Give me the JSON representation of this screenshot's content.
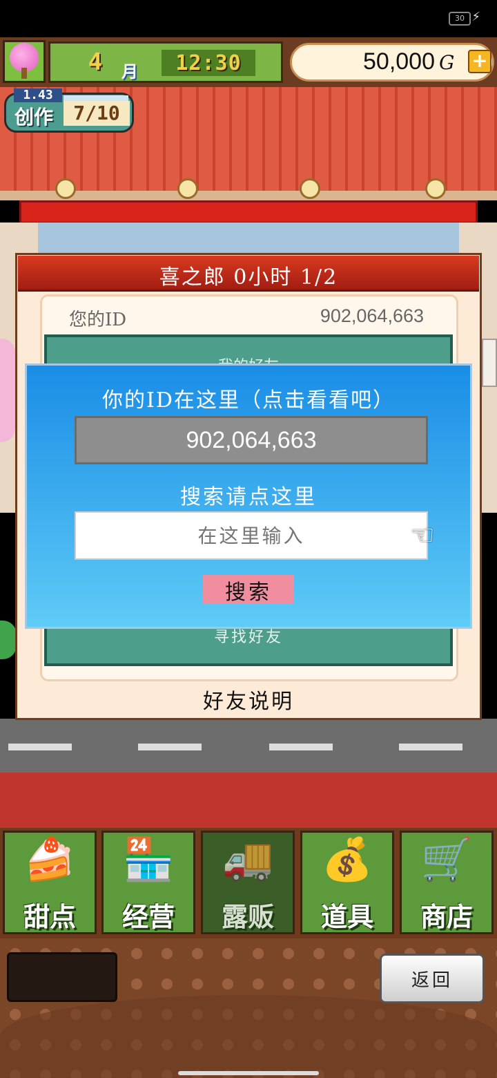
{
  "status": {
    "battery": "30"
  },
  "hud": {
    "month_number": "4",
    "month_unit": "月",
    "time": "12:30",
    "money": "50,000",
    "money_unit": "G",
    "add_money": "+"
  },
  "dev_badge": {
    "label": "创作",
    "level": "1.43",
    "progress": "7/10"
  },
  "panel": {
    "title": "喜之郎  0小时 1/2",
    "your_id_label": "您的ID",
    "your_id_value": "902,064,663",
    "hidden_line": "我的好友",
    "find_friends": "寻找好友",
    "friend_help": "好友说明"
  },
  "dialog": {
    "title": "你的ID在这里（点击看看吧）",
    "id_value": "902,064,663",
    "search_hint": "搜索请点这里",
    "search_placeholder": "在这里输入",
    "search_button": "搜索"
  },
  "nav": {
    "items": [
      {
        "label": "甜点",
        "icon": "cake-icon"
      },
      {
        "label": "经营",
        "icon": "shop-icon"
      },
      {
        "label": "露贩",
        "icon": "food-truck-icon"
      },
      {
        "label": "道具",
        "icon": "item-bag-icon"
      },
      {
        "label": "商店",
        "icon": "shopping-cart-icon"
      }
    ],
    "active_index": 2
  },
  "footer": {
    "back_button": "返回"
  },
  "colors": {
    "dialog_blue": "#1a8de6",
    "header_red": "#d93a20",
    "nav_green": "#5d9a3c",
    "search_button_pink": "#f08ea0"
  }
}
